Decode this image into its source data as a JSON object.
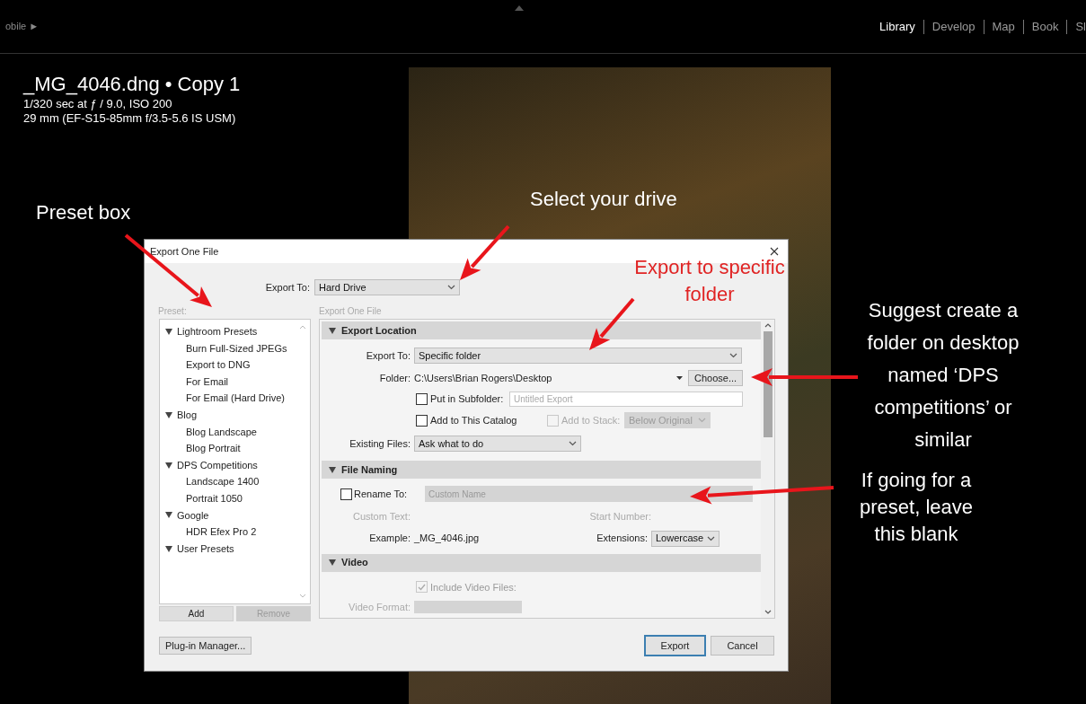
{
  "top_bar": {
    "left_label": "obile ►",
    "modules": [
      {
        "label": "Library",
        "selected": true
      },
      {
        "label": "Develop",
        "selected": false
      },
      {
        "label": "Map",
        "selected": false
      },
      {
        "label": "Book",
        "selected": false
      },
      {
        "label": "Sl",
        "selected": false
      }
    ]
  },
  "photo_info": {
    "title": "_MG_4046.dng • Copy 1",
    "exposure": "1/320 sec at ƒ / 9.0, ISO 200",
    "lens": "29 mm (EF-S15-85mm f/3.5-5.6 IS USM)"
  },
  "dialog": {
    "title": "Export One File",
    "export_to": {
      "label": "Export To:",
      "value": "Hard Drive"
    },
    "preset_label": "Preset:",
    "presets": [
      {
        "label": "Lightroom Presets",
        "expanded": true,
        "children": [
          {
            "label": "Burn Full-Sized JPEGs"
          },
          {
            "label": "Export to DNG"
          },
          {
            "label": "For Email"
          },
          {
            "label": "For Email (Hard Drive)"
          }
        ]
      },
      {
        "label": "Blog",
        "expanded": true,
        "children": [
          {
            "label": "Blog Landscape"
          },
          {
            "label": "Blog Portrait"
          }
        ]
      },
      {
        "label": "DPS Competitions",
        "expanded": true,
        "children": [
          {
            "label": "Landscape 1400"
          },
          {
            "label": "Portrait 1050"
          }
        ]
      },
      {
        "label": "Google",
        "expanded": true,
        "children": [
          {
            "label": "HDR Efex Pro 2"
          }
        ]
      },
      {
        "label": "User Presets",
        "expanded": true
      }
    ],
    "preset_buttons": [
      {
        "label": "Add",
        "disabled": false
      },
      {
        "label": "Remove",
        "disabled": true
      }
    ],
    "settings_label": "Export One File",
    "export_location": {
      "title": "Export Location",
      "expanded": true,
      "export_to": {
        "label": "Export To:",
        "value": "Specific folder"
      },
      "folder": {
        "label": "Folder:",
        "value": "C:\\Users\\Brian Rogers\\Desktop",
        "button": "Choose..."
      },
      "subfolder": {
        "label": "Put in Subfolder:",
        "checked": false,
        "placeholder": "Untitled Export"
      },
      "add_to_catalog": {
        "label": "Add to This Catalog",
        "checked": false
      },
      "add_to_stack": {
        "label": "Add to Stack:",
        "checked": false,
        "disabled": true,
        "value": "Below Original"
      },
      "existing_files": {
        "label": "Existing Files:",
        "value": "Ask what to do"
      }
    },
    "file_naming": {
      "title": "File Naming",
      "expanded": true,
      "rename": {
        "label": "Rename To:",
        "checked": false,
        "placeholder": "Custom Name"
      },
      "custom_text": {
        "label": "Custom Text:"
      },
      "start_number": {
        "label": "Start Number:"
      },
      "example": {
        "label": "Example:",
        "value": "_MG_4046.jpg"
      },
      "extensions": {
        "label": "Extensions:",
        "value": "Lowercase"
      }
    },
    "video": {
      "title": "Video",
      "expanded": true,
      "include_video": {
        "label": "Include Video Files:",
        "checked": true,
        "disabled": true
      },
      "video_format": {
        "label": "Video Format:"
      }
    },
    "plugin_button": "Plug-in Manager...",
    "export_button": "Export",
    "cancel_button": "Cancel"
  },
  "annotations": [
    {
      "kind": "white",
      "text": "Preset box"
    },
    {
      "kind": "white",
      "text": "Select your drive"
    },
    {
      "kind": "red",
      "text": "Export to specific folder"
    },
    {
      "kind": "white",
      "text": "Suggest create a folder on desktop named ‘DPS competitions’ or similar"
    },
    {
      "kind": "white",
      "text": "If going for a preset, leave this blank"
    }
  ]
}
